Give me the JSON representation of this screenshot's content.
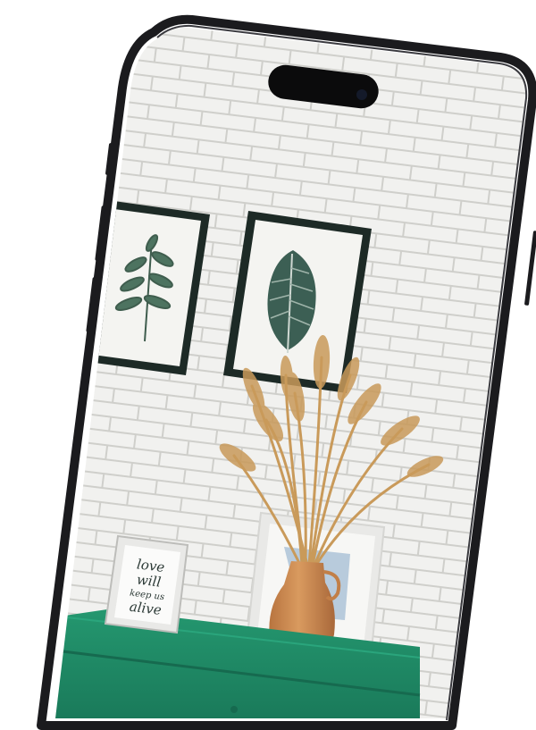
{
  "phone_frame": {
    "color": "#1b1b1e",
    "bezel_highlight": "#3a3a3f"
  },
  "wall": {
    "brick_color": "#f1f1ef",
    "mortar_color": "#cfcfcb"
  },
  "art_frames": {
    "frame_color": "#1d2a26",
    "mat_color": "#f4f4f1",
    "small_frame_color": "#e9e9e7"
  },
  "plant_vase": {
    "vase_color": "#d08d52",
    "pampas_color": "#c99a5a"
  },
  "cabinet": {
    "color": "#1f8a66",
    "shadow_color": "#166a4f"
  },
  "quote_frame": {
    "line1": "love",
    "line2": "will",
    "line3": "keep us",
    "line4": "alive",
    "ink_color": "#2c3a36"
  }
}
